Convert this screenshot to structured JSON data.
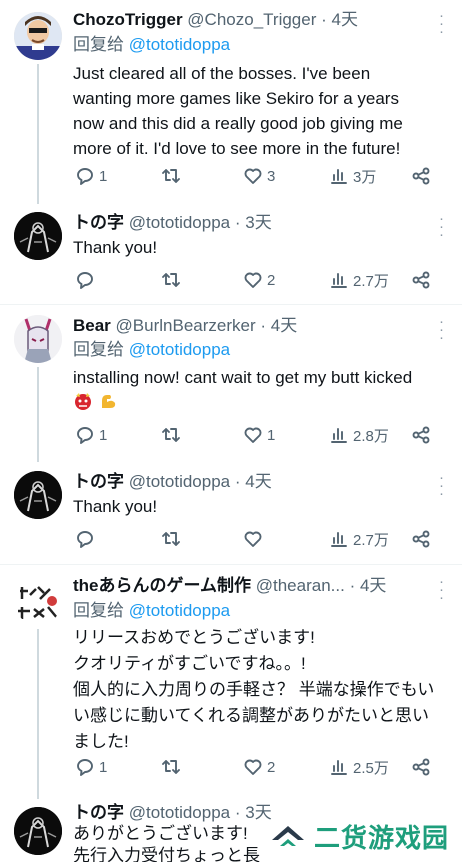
{
  "tweets": [
    {
      "name": "ChozoTrigger",
      "handle": "@Chozo_Trigger",
      "dot": "·",
      "time": "4天",
      "reply_prefix": "回复给",
      "reply_to": "@tototidoppa",
      "text_lines": [
        "Just cleared all of the bosses. I've been",
        "wanting more games like Sekiro for a years",
        "now and this did a really good job giving me",
        "more of it. I'd love to see more in the future!"
      ],
      "replies": "1",
      "retweets": "",
      "likes": "3",
      "views": "3万"
    },
    {
      "name": "トの字",
      "handle": "@tototidoppa",
      "dot": "·",
      "time": "3天",
      "text_lines": [
        "Thank you!"
      ],
      "replies": "",
      "retweets": "",
      "likes": "2",
      "views": "2.7万"
    },
    {
      "name": "Bear",
      "handle": "@BurlnBearzerker",
      "dot": "·",
      "time": "4天",
      "reply_prefix": "回复给",
      "reply_to": "@tototidoppa",
      "text_lines": [
        "installing now! cant wait to get my butt kicked"
      ],
      "emojis": [
        "ogre-emoji",
        "flexed-biceps-emoji"
      ],
      "replies": "1",
      "retweets": "",
      "likes": "1",
      "views": "2.8万"
    },
    {
      "name": "トの字",
      "handle": "@tototidoppa",
      "dot": "·",
      "time": "4天",
      "text_lines": [
        "Thank you!"
      ],
      "replies": "",
      "retweets": "",
      "likes": "",
      "views": "2.7万"
    },
    {
      "name": "theあらんのゲーム制作",
      "handle": "@thearan...",
      "dot": "·",
      "time": "4天",
      "reply_prefix": "回复给",
      "reply_to": "@tototidoppa",
      "text_lines": [
        "リリースおめでとうございます!",
        "クオリティがすごいですね。。!",
        "個人的に入力周りの手軽さ？ 半端な操作でもい",
        "い感じに動いてくれる調整がありがたいと思い",
        "ました!"
      ],
      "replies": "1",
      "retweets": "",
      "likes": "2",
      "views": "2.5万"
    },
    {
      "name": "トの字",
      "handle": "@tototidoppa",
      "dot": "·",
      "time": "3天",
      "text_lines": [
        "ありがとうございます!",
        "先行入力受付ちょっと長"
      ]
    }
  ],
  "icons": {
    "reply": "reply-icon",
    "retweet": "retweet-icon",
    "like": "heart-icon",
    "views": "views-icon",
    "share": "share-icon",
    "more": "more-icon"
  },
  "watermark": {
    "text": "二货游戏园"
  },
  "colors": {
    "link": "#1d9bf0",
    "muted": "#536471",
    "watermark": "#1e9e7c"
  }
}
